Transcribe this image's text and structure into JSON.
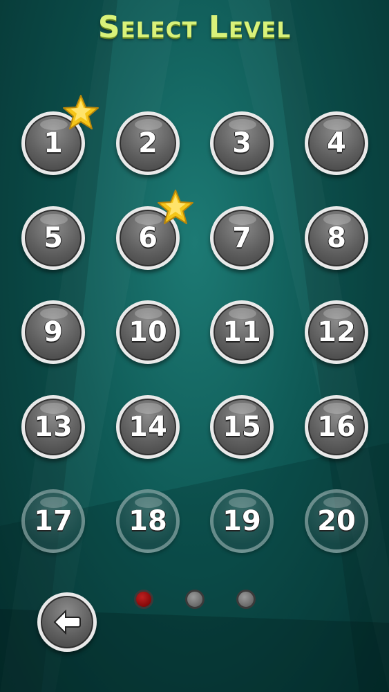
{
  "title": "Select Level",
  "levels": [
    {
      "label": "1",
      "state": "unlocked",
      "starred": true
    },
    {
      "label": "2",
      "state": "unlocked",
      "starred": false
    },
    {
      "label": "3",
      "state": "unlocked",
      "starred": false
    },
    {
      "label": "4",
      "state": "unlocked",
      "starred": false
    },
    {
      "label": "5",
      "state": "unlocked",
      "starred": false
    },
    {
      "label": "6",
      "state": "unlocked",
      "starred": true
    },
    {
      "label": "7",
      "state": "unlocked",
      "starred": false
    },
    {
      "label": "8",
      "state": "unlocked",
      "starred": false
    },
    {
      "label": "9",
      "state": "unlocked",
      "starred": false
    },
    {
      "label": "10",
      "state": "unlocked",
      "starred": false
    },
    {
      "label": "11",
      "state": "unlocked",
      "starred": false
    },
    {
      "label": "12",
      "state": "unlocked",
      "starred": false
    },
    {
      "label": "13",
      "state": "unlocked",
      "starred": false
    },
    {
      "label": "14",
      "state": "unlocked",
      "starred": false
    },
    {
      "label": "15",
      "state": "unlocked",
      "starred": false
    },
    {
      "label": "16",
      "state": "unlocked",
      "starred": false
    },
    {
      "label": "17",
      "state": "locked",
      "starred": false
    },
    {
      "label": "18",
      "state": "locked",
      "starred": false
    },
    {
      "label": "19",
      "state": "locked",
      "starred": false
    },
    {
      "label": "20",
      "state": "locked",
      "starred": false
    }
  ],
  "pager": {
    "pages": 3,
    "current": 1
  },
  "icons": {
    "back": "back-arrow-icon",
    "star": "star-icon"
  },
  "colors": {
    "title": "#d9f27a",
    "background": "#0f5a56",
    "button_ring": "#e9e9e9",
    "button_fill": "#5e5e5e",
    "star": "#f5c518",
    "active_dot": "#c02020"
  }
}
